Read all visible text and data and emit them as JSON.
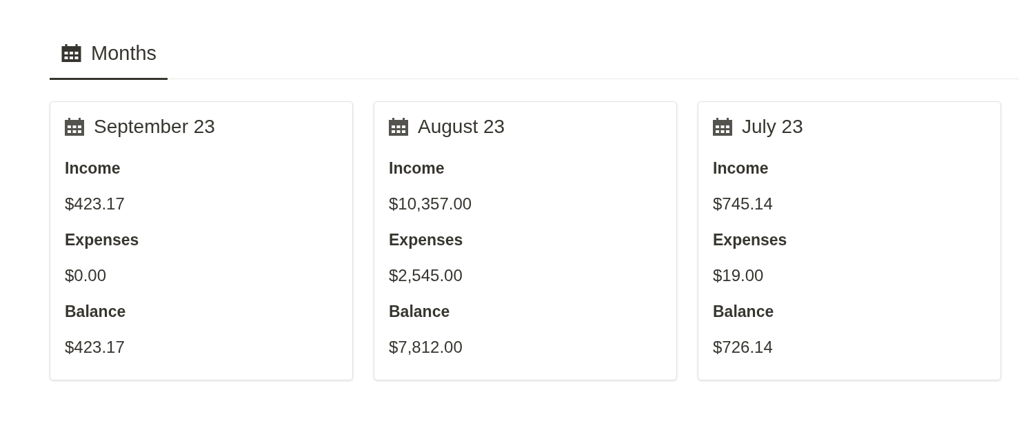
{
  "tabs": [
    {
      "label": "Months",
      "selected": true
    }
  ],
  "cards": [
    {
      "title": "September 23",
      "fields": [
        {
          "label": "Income",
          "value": "$423.17"
        },
        {
          "label": "Expenses",
          "value": "$0.00"
        },
        {
          "label": "Balance",
          "value": "$423.17"
        }
      ]
    },
    {
      "title": "August 23",
      "fields": [
        {
          "label": "Income",
          "value": "$10,357.00"
        },
        {
          "label": "Expenses",
          "value": "$2,545.00"
        },
        {
          "label": "Balance",
          "value": "$7,812.00"
        }
      ]
    },
    {
      "title": "July 23",
      "fields": [
        {
          "label": "Income",
          "value": "$745.14"
        },
        {
          "label": "Expenses",
          "value": "$19.00"
        },
        {
          "label": "Balance",
          "value": "$726.14"
        }
      ]
    }
  ]
}
